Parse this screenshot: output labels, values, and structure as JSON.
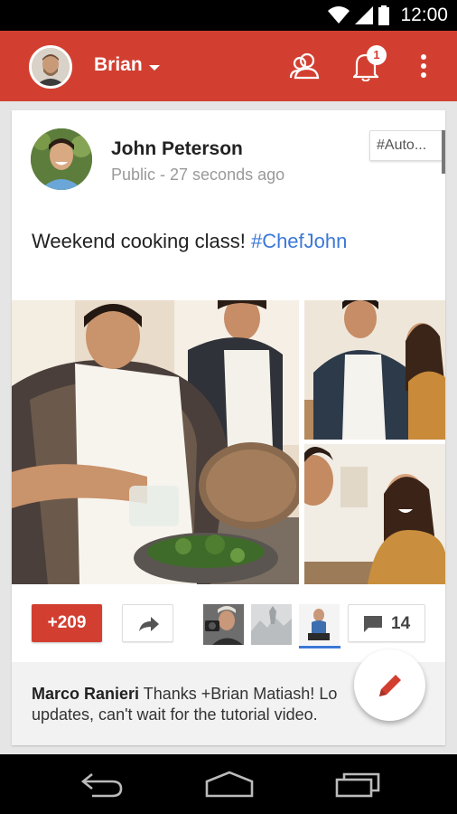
{
  "status_bar": {
    "time": "12:00"
  },
  "app_bar": {
    "account_name": "Brian",
    "notification_count": "1"
  },
  "post": {
    "author": "John Peterson",
    "meta": "Public - 27 seconds ago",
    "tag": "#Auto...",
    "text": "Weekend cooking class! ",
    "hashtag": "#ChefJohn",
    "plus_count": "+209",
    "comment_count": "14",
    "comment_author": "Marco Ranieri",
    "comment_body": " Thanks +Brian Matiash! Lo updates, can't wait for the tutorial video."
  },
  "colors": {
    "brand_red": "#d23f31",
    "link_blue": "#3b78d8"
  }
}
